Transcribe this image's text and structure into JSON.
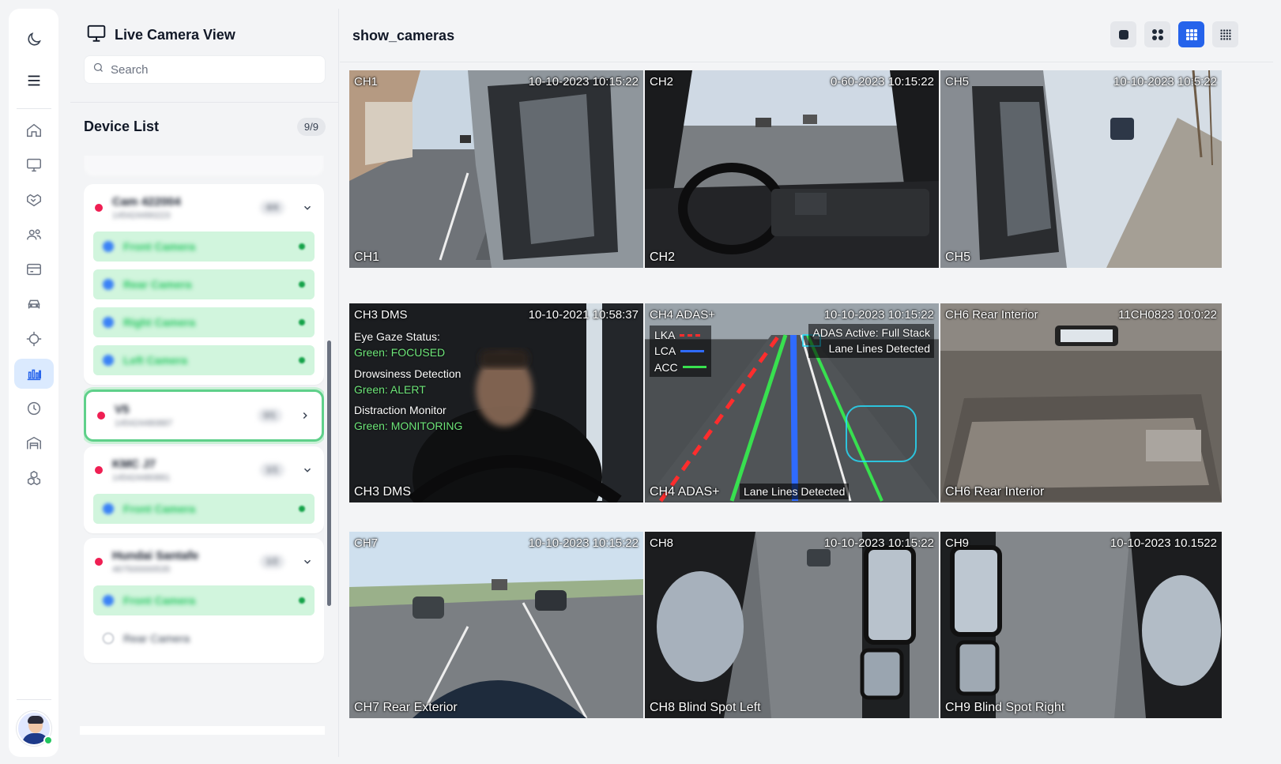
{
  "app": {
    "panel_title": "Live Camera View",
    "search_placeholder": "Search",
    "main_title": "show_cameras"
  },
  "rail": {
    "top_icons": [
      "moon-icon",
      "menu-icon"
    ],
    "nav_icons": [
      "home-icon",
      "monitor-icon",
      "handshake-icon",
      "users-icon",
      "card-icon",
      "car-icon",
      "crosshair-icon",
      "chart-icon",
      "clock-icon",
      "garage-icon",
      "cubes-icon"
    ],
    "active_nav": "chart-icon",
    "online_color": "#22c55e"
  },
  "device_list": {
    "title": "Device List",
    "count": "9/9",
    "devices": [
      {
        "name": "Cam 422004",
        "id": "145424490223",
        "count": "4/4",
        "expanded": true,
        "cameras": [
          {
            "label": "Front Camera",
            "online": true
          },
          {
            "label": "Rear Camera",
            "online": true
          },
          {
            "label": "Right Camera",
            "online": true
          },
          {
            "label": "Left Camera",
            "online": true
          }
        ]
      },
      {
        "name": "V5",
        "id": "145424480887",
        "count": "0/1",
        "expanded": false,
        "selected": true,
        "cameras": []
      },
      {
        "name": "KMC J7",
        "id": "145424480881",
        "count": "1/1",
        "expanded": true,
        "cameras": [
          {
            "label": "Front Camera",
            "online": true
          }
        ]
      },
      {
        "name": "Hundai Santafe",
        "id": "467500000535",
        "count": "1/2",
        "expanded": true,
        "cameras": [
          {
            "label": "Front Camera",
            "online": true
          },
          {
            "label": "Rear Camera",
            "online": false
          }
        ]
      }
    ]
  },
  "layout_buttons": [
    "single-layout-icon",
    "grid-2x2-icon",
    "grid-3x3-icon",
    "grid-4x4-icon"
  ],
  "active_layout": "grid-3x3-icon",
  "tiles": [
    {
      "tl": "CH1",
      "tr": "10-10-2023 10:15:22",
      "bl": "CH1"
    },
    {
      "tl": "CH2",
      "tr": "0-60-2023 10:15:22",
      "bl": "CH2"
    },
    {
      "tl": "CH5",
      "tr": "10-10-2023 10:5:22",
      "bl": "CH5"
    },
    {
      "tl": "CH3 DMS",
      "tr": "10-10-2021 10:58:37",
      "bl": "CH3 DMS",
      "overlay": [
        "Eye Gaze Status:",
        "Green: FOCUSED",
        "Drowsiness Detection",
        "Green: ALERT",
        "Distraction Monitor",
        "Green: MONITORING"
      ]
    },
    {
      "tl": "CH4 ADAS+",
      "tr": "10-10-2023 10:15:22",
      "bl": "CH4 ADAS+",
      "legend": [
        "LKA",
        "LCA",
        "ACC"
      ],
      "status": [
        "ADAS Active: Full Stack",
        "Lane Lines Detected"
      ],
      "bottom_badge": "Lane Lines Detected"
    },
    {
      "tl": "CH6 Rear Interior",
      "tr": "11CH0823 10:0:22",
      "bl": "CH6 Rear Interior"
    },
    {
      "tl": "CH7",
      "tr": "10-10-2023 10:15:22",
      "bl": "CH7 Rear Exterior"
    },
    {
      "tl": "CH8",
      "tr": "10-10-2023 10:15:22",
      "bl": "CH8 Blind Spot Left"
    },
    {
      "tl": "CH9",
      "tr": "10-10-2023 10.1522",
      "bl": "CH9 Blind Spot Right"
    }
  ]
}
